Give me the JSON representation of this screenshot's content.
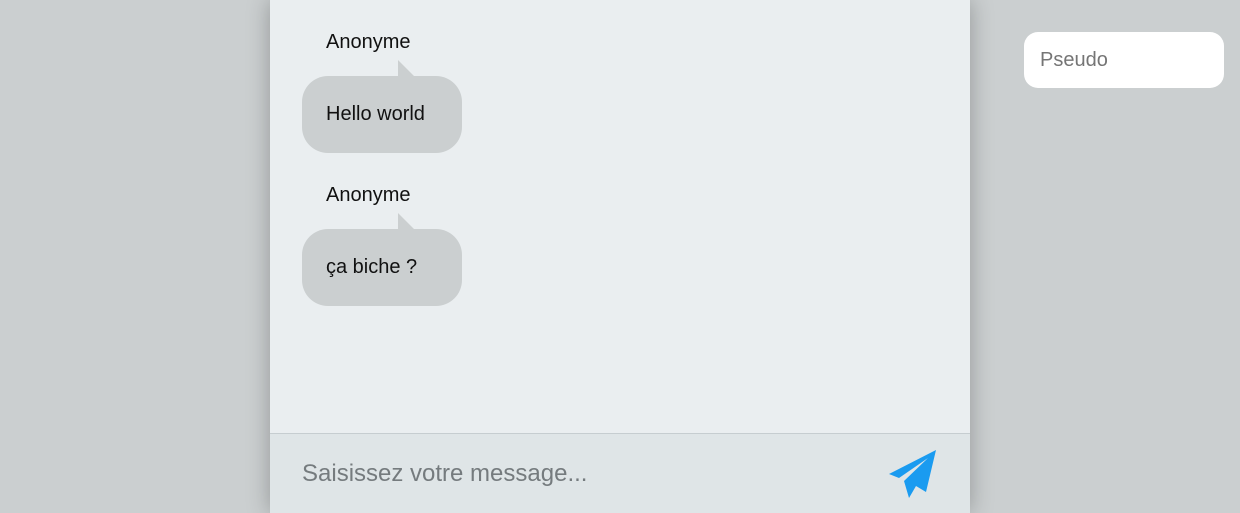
{
  "chat": {
    "messages": [
      {
        "author": "Anonyme",
        "text": "Hello world"
      },
      {
        "author": "Anonyme",
        "text": "ça biche ?"
      }
    ],
    "composer": {
      "placeholder": "Saisissez votre message...",
      "value": "",
      "send_icon": "paper-plane-icon"
    }
  },
  "pseudo": {
    "placeholder": "Pseudo",
    "value": ""
  },
  "colors": {
    "page_background": "#cbcfd0",
    "chat_background": "#eaeef0",
    "composer_background": "#dfe5e7",
    "bubble": "#cbcfd0",
    "accent": "#1a9bf0"
  }
}
